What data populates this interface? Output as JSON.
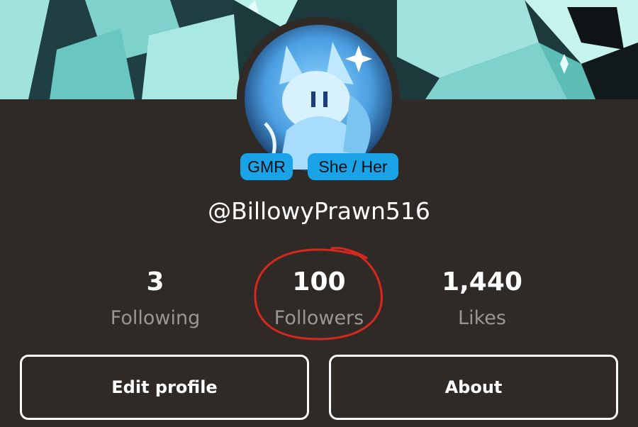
{
  "profile": {
    "badges": [
      "GMR",
      "She / Her"
    ],
    "username": "@BillowyPrawn516"
  },
  "stats": [
    {
      "value": "3",
      "label": "Following"
    },
    {
      "value": "100",
      "label": "Followers"
    },
    {
      "value": "1,440",
      "label": "Likes"
    }
  ],
  "actions": {
    "edit_label": "Edit profile",
    "about_label": "About"
  },
  "annotation": {
    "color": "#d6281e"
  },
  "colors": {
    "background": "#2f2a26",
    "badge": "#1aa3e6",
    "banner": "#8fd8d4",
    "muted_text": "#9a9792"
  }
}
